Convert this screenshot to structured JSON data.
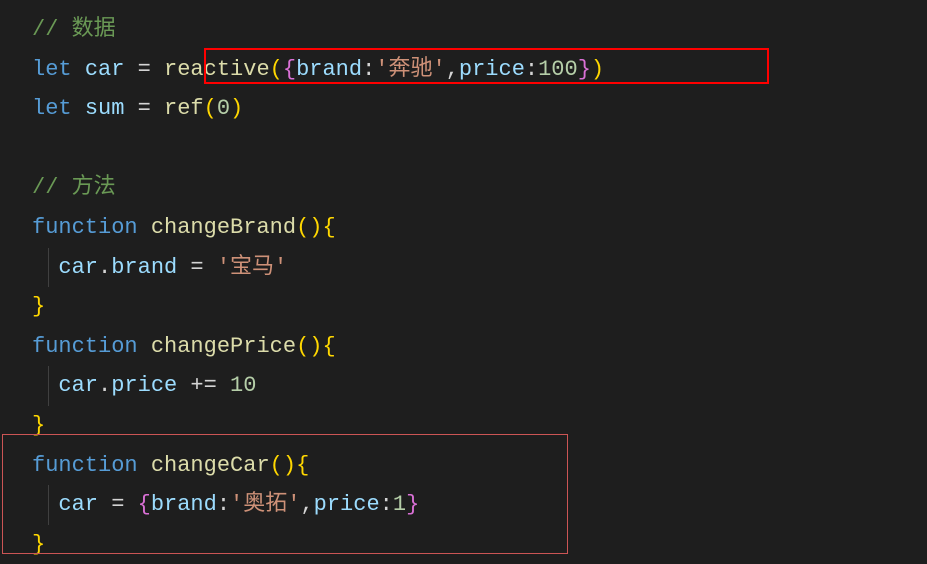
{
  "code": {
    "comment1": "// 数据",
    "line2": {
      "keyword": "let",
      "var": "car",
      "eq": " = ",
      "func": "reactive",
      "openParen": "(",
      "openBrace": "{",
      "prop1": "brand",
      "colon1": ":",
      "str1": "'奔驰'",
      "comma1": ",",
      "prop2": "price",
      "colon2": ":",
      "num1": "100",
      "closeBrace": "}",
      "closeParen": ")"
    },
    "line3": {
      "keyword": "let",
      "var": "sum",
      "eq": " = ",
      "func": "ref",
      "openParen": "(",
      "num": "0",
      "closeParen": ")"
    },
    "comment2": "// 方法",
    "line6": {
      "keyword": "function",
      "func": "changeBrand",
      "parens": "()",
      "brace": "{"
    },
    "line7": {
      "obj": "car",
      "dot": ".",
      "prop": "brand",
      "eq": " = ",
      "str": "'宝马'"
    },
    "line8": {
      "brace": "}"
    },
    "line9": {
      "keyword": "function",
      "func": "changePrice",
      "parens": "()",
      "brace": "{"
    },
    "line10": {
      "obj": "car",
      "dot": ".",
      "prop": "price",
      "op": " += ",
      "num": "10"
    },
    "line11": {
      "brace": "}"
    },
    "line12": {
      "keyword": "function",
      "func": "changeCar",
      "parens": "()",
      "brace": "{"
    },
    "line13": {
      "var": "car",
      "eq": " = ",
      "openBrace": "{",
      "prop1": "brand",
      "colon1": ":",
      "str1": "'奥拓'",
      "comma1": ",",
      "prop2": "price",
      "colon2": ":",
      "num1": "1",
      "closeBrace": "}"
    },
    "line14": {
      "brace": "}"
    }
  }
}
